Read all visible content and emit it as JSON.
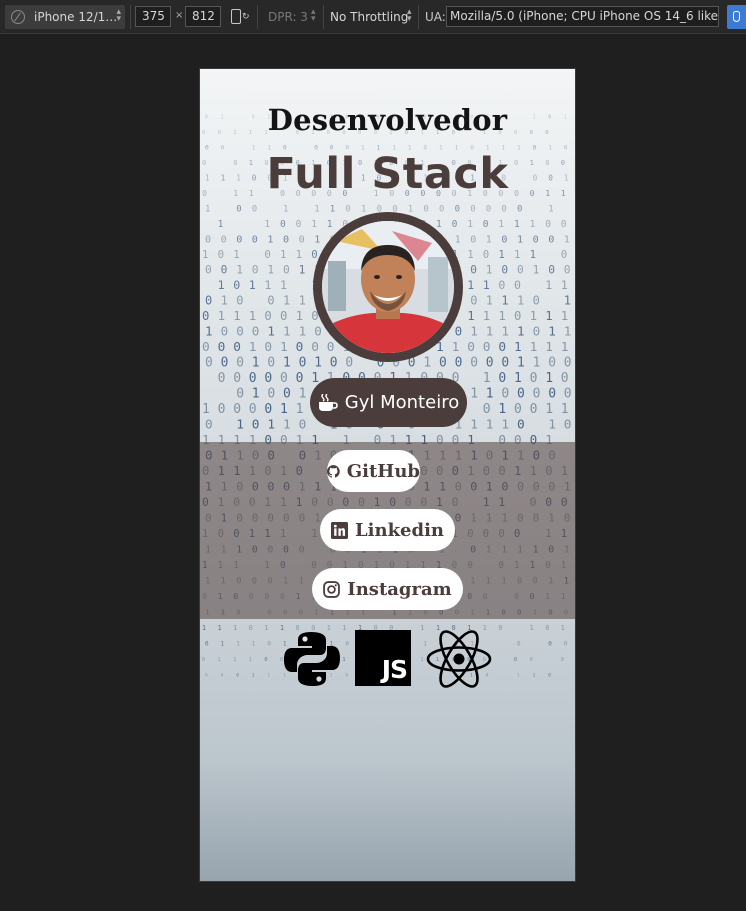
{
  "devtools": {
    "device": "iPhone 12/1…",
    "width": "375",
    "x_sep": "×",
    "height": "812",
    "dpr": "DPR: 3",
    "throttling": "No Throttling",
    "ua_label": "UA:",
    "ua_value": "Mozilla/5.0 (iPhone; CPU iPhone OS 14_6 like Mac"
  },
  "page": {
    "title_line1": "Desenvolvedor",
    "title_line2": "Full Stack",
    "name": "Gyl Monteiro",
    "links": [
      {
        "label": "GitHub",
        "icon": "github-icon"
      },
      {
        "label": "Linkedin",
        "icon": "linkedin-icon"
      },
      {
        "label": "Instagram",
        "icon": "instagram-icon"
      }
    ],
    "tech": [
      {
        "name": "python-icon"
      },
      {
        "name": "javascript-icon",
        "label": "JS"
      },
      {
        "name": "react-icon"
      }
    ],
    "colors": {
      "brand": "#4b3d3b",
      "pill_bg": "#ffffff",
      "band": "#5a4846"
    }
  }
}
